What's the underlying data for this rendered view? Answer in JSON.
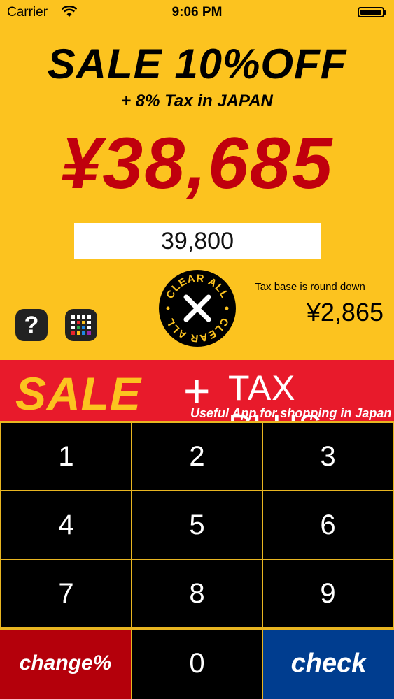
{
  "status_bar": {
    "carrier": "Carrier",
    "time": "9:06 PM",
    "wifi_icon": "wifi-icon",
    "battery_icon": "battery-icon"
  },
  "promo": {
    "headline": "SALE 10%OFF",
    "subline": "+ 8% Tax in JAPAN",
    "total": "¥38,685"
  },
  "price_input": {
    "value": "39,800"
  },
  "clear_button": {
    "ring_top": "CLEAR ALL",
    "ring_bottom": "CLEAR ALL",
    "icon": "close-icon"
  },
  "tax": {
    "note": "Tax base is round down",
    "amount": "¥2,865"
  },
  "buttons": {
    "help_glyph": "?",
    "help_icon": "help-icon",
    "apps_icon": "apps-grid-icon"
  },
  "banner": {
    "sale": "SALE",
    "plus": "+",
    "tax_plus": "TAX PLUS",
    "tagline": "Useful App for shopping in Japan"
  },
  "keypad": {
    "keys": [
      "1",
      "2",
      "3",
      "4",
      "5",
      "6",
      "7",
      "8",
      "9"
    ],
    "change": "change%",
    "zero": "0",
    "check": "check"
  },
  "colors": {
    "background": "#fcc31f",
    "total_red": "#c0000d",
    "banner_red": "#e81a2b",
    "change_red": "#b4000b",
    "check_blue": "#003d8f",
    "grid_line": "#e8b521"
  }
}
